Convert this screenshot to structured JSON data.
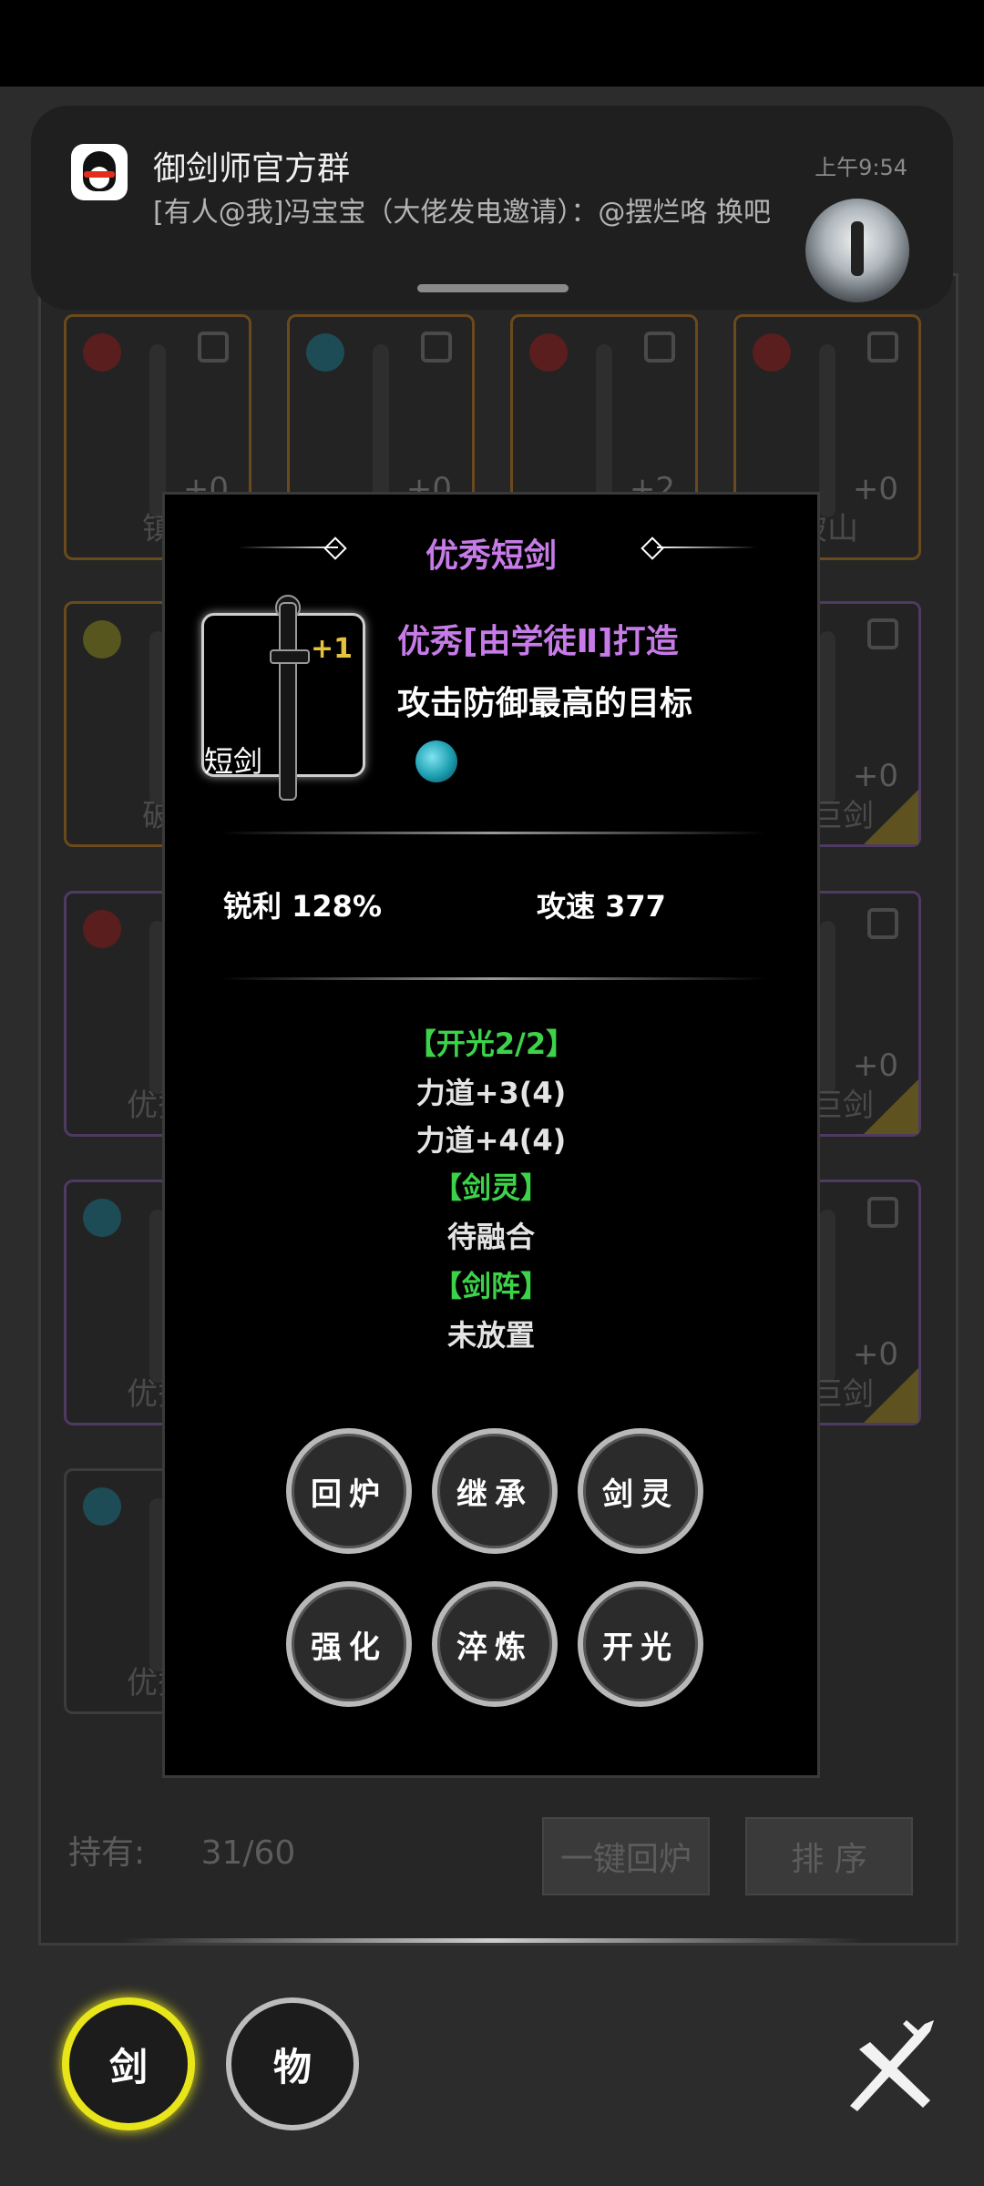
{
  "notification": {
    "title": "御剑师官方群",
    "time": "上午9:54",
    "message": "[有人@我]冯宝宝（大佬发电邀请）：@摆烂咯 换吧"
  },
  "background_cards": [
    {
      "plus": "+0",
      "name": "镇"
    },
    {
      "plus": "+0",
      "name": ""
    },
    {
      "plus": "+2",
      "name": ""
    },
    {
      "plus": "+0",
      "name": "破山"
    },
    {
      "plus": "",
      "name": "破"
    },
    {
      "plus": "+0",
      "name": "宗巨剑"
    },
    {
      "plus": "",
      "name": "优秀"
    },
    {
      "plus": "+0",
      "name": "宗巨剑"
    },
    {
      "plus": "",
      "name": "优秀"
    },
    {
      "plus": "+0",
      "name": "宗巨剑"
    },
    {
      "plus": "",
      "name": "优秀"
    }
  ],
  "footer": {
    "hold_label": "持有:",
    "hold_value": "31/60",
    "recycle_all": "一键回炉",
    "sort": "排 序"
  },
  "dialog": {
    "title": "优秀短剑",
    "sword_type": "短剑",
    "plus_level": "+1",
    "maker": "优秀[由学徒Ⅱ]打造",
    "tactic": "攻击防御最高的目标",
    "stats": {
      "sharpness": "锐利 128%",
      "speed": "攻速 377"
    },
    "sections": [
      {
        "text": "【开光2/2】",
        "color": "green"
      },
      {
        "text": "力道+3(4)",
        "color": "white"
      },
      {
        "text": "力道+4(4)",
        "color": "white"
      },
      {
        "text": "【剑灵】",
        "color": "green"
      },
      {
        "text": "待融合",
        "color": "white"
      },
      {
        "text": "【剑阵】",
        "color": "green"
      },
      {
        "text": "未放置",
        "color": "white"
      }
    ],
    "buttons": [
      "回炉",
      "继承",
      "剑灵",
      "强化",
      "淬炼",
      "开光"
    ]
  },
  "tabs": {
    "sword": "剑",
    "item": "物"
  },
  "colors": {
    "accent_purple": "#c77be8",
    "accent_green": "#3cd34a",
    "tab_highlight": "#e8e61a",
    "plus_gold": "#e6c33c"
  },
  "icons": {
    "close": "crossed-swords-icon",
    "app": "qq-penguin-icon",
    "spirit_orb": "cyan-orb-icon"
  }
}
